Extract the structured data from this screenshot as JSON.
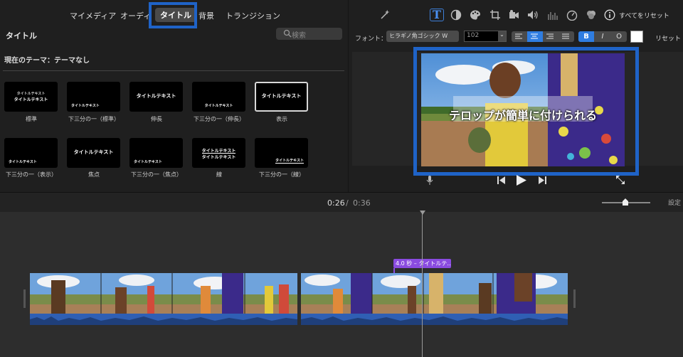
{
  "tabs": [
    {
      "label": "マイメディア"
    },
    {
      "label": "オーディ"
    },
    {
      "label": "タイトル"
    },
    {
      "label": "背景"
    },
    {
      "label": "トランジション"
    }
  ],
  "browser": {
    "title": "タイトル",
    "search_placeholder": "検索",
    "current_theme": "現在のテーマ：テーマなし"
  },
  "title_styles": [
    {
      "name": "標準",
      "line1": "タイトルテキスト",
      "line2": "タイトルテキスト"
    },
    {
      "name": "下三分の一（標準）",
      "line1": "タイトルテキスト",
      "line2": ""
    },
    {
      "name": "伸長",
      "line1": "タイトルテキスト",
      "line2": ""
    },
    {
      "name": "下三分の一（伸長）",
      "line1": "タイトルテキスト",
      "line2": ""
    },
    {
      "name": "表示",
      "line1": "タイトルテキスト",
      "line2": ""
    },
    {
      "name": "下三分の一（表示）",
      "line1": "タイトルテキスト",
      "line2": ""
    },
    {
      "name": "焦点",
      "line1": "タイトルテキスト",
      "line2": ""
    },
    {
      "name": "下三分の一（焦点）",
      "line1": "タイトルテキスト",
      "line2": ""
    },
    {
      "name": "線",
      "line1": "タイトルテキスト",
      "line2": "タイトルテキスト"
    },
    {
      "name": "下三分の一（線）",
      "line1": "タイトルテキスト",
      "line2": ""
    }
  ],
  "toolbar": {
    "reset_all": "すべてをリセット",
    "icons": [
      "magic-wand-icon",
      "title-text-icon",
      "color-balance-icon",
      "palette-icon",
      "crop-icon",
      "camera-icon",
      "volume-icon",
      "equalizer-icon",
      "speedometer-icon",
      "filter-icon",
      "info-icon"
    ]
  },
  "font_controls": {
    "font_label": "フォント：",
    "font_value": "ヒラギノ角ゴシック W",
    "size_value": "102",
    "bold": "B",
    "italic": "I",
    "outline": "O",
    "reset": "リセット"
  },
  "viewer": {
    "caption": "テロップが簡単に付けられる"
  },
  "timeline": {
    "current_time": "0:26",
    "separator": "/",
    "total_time": "0:36",
    "settings": "設定",
    "title_clip_label": "4.0 秒 – タイトルテ…"
  },
  "colors": {
    "highlight": "#1f63c7",
    "title_clip": "#8a4be0",
    "audio": "#2f5fb4",
    "accent_button": "#2f7de1"
  }
}
